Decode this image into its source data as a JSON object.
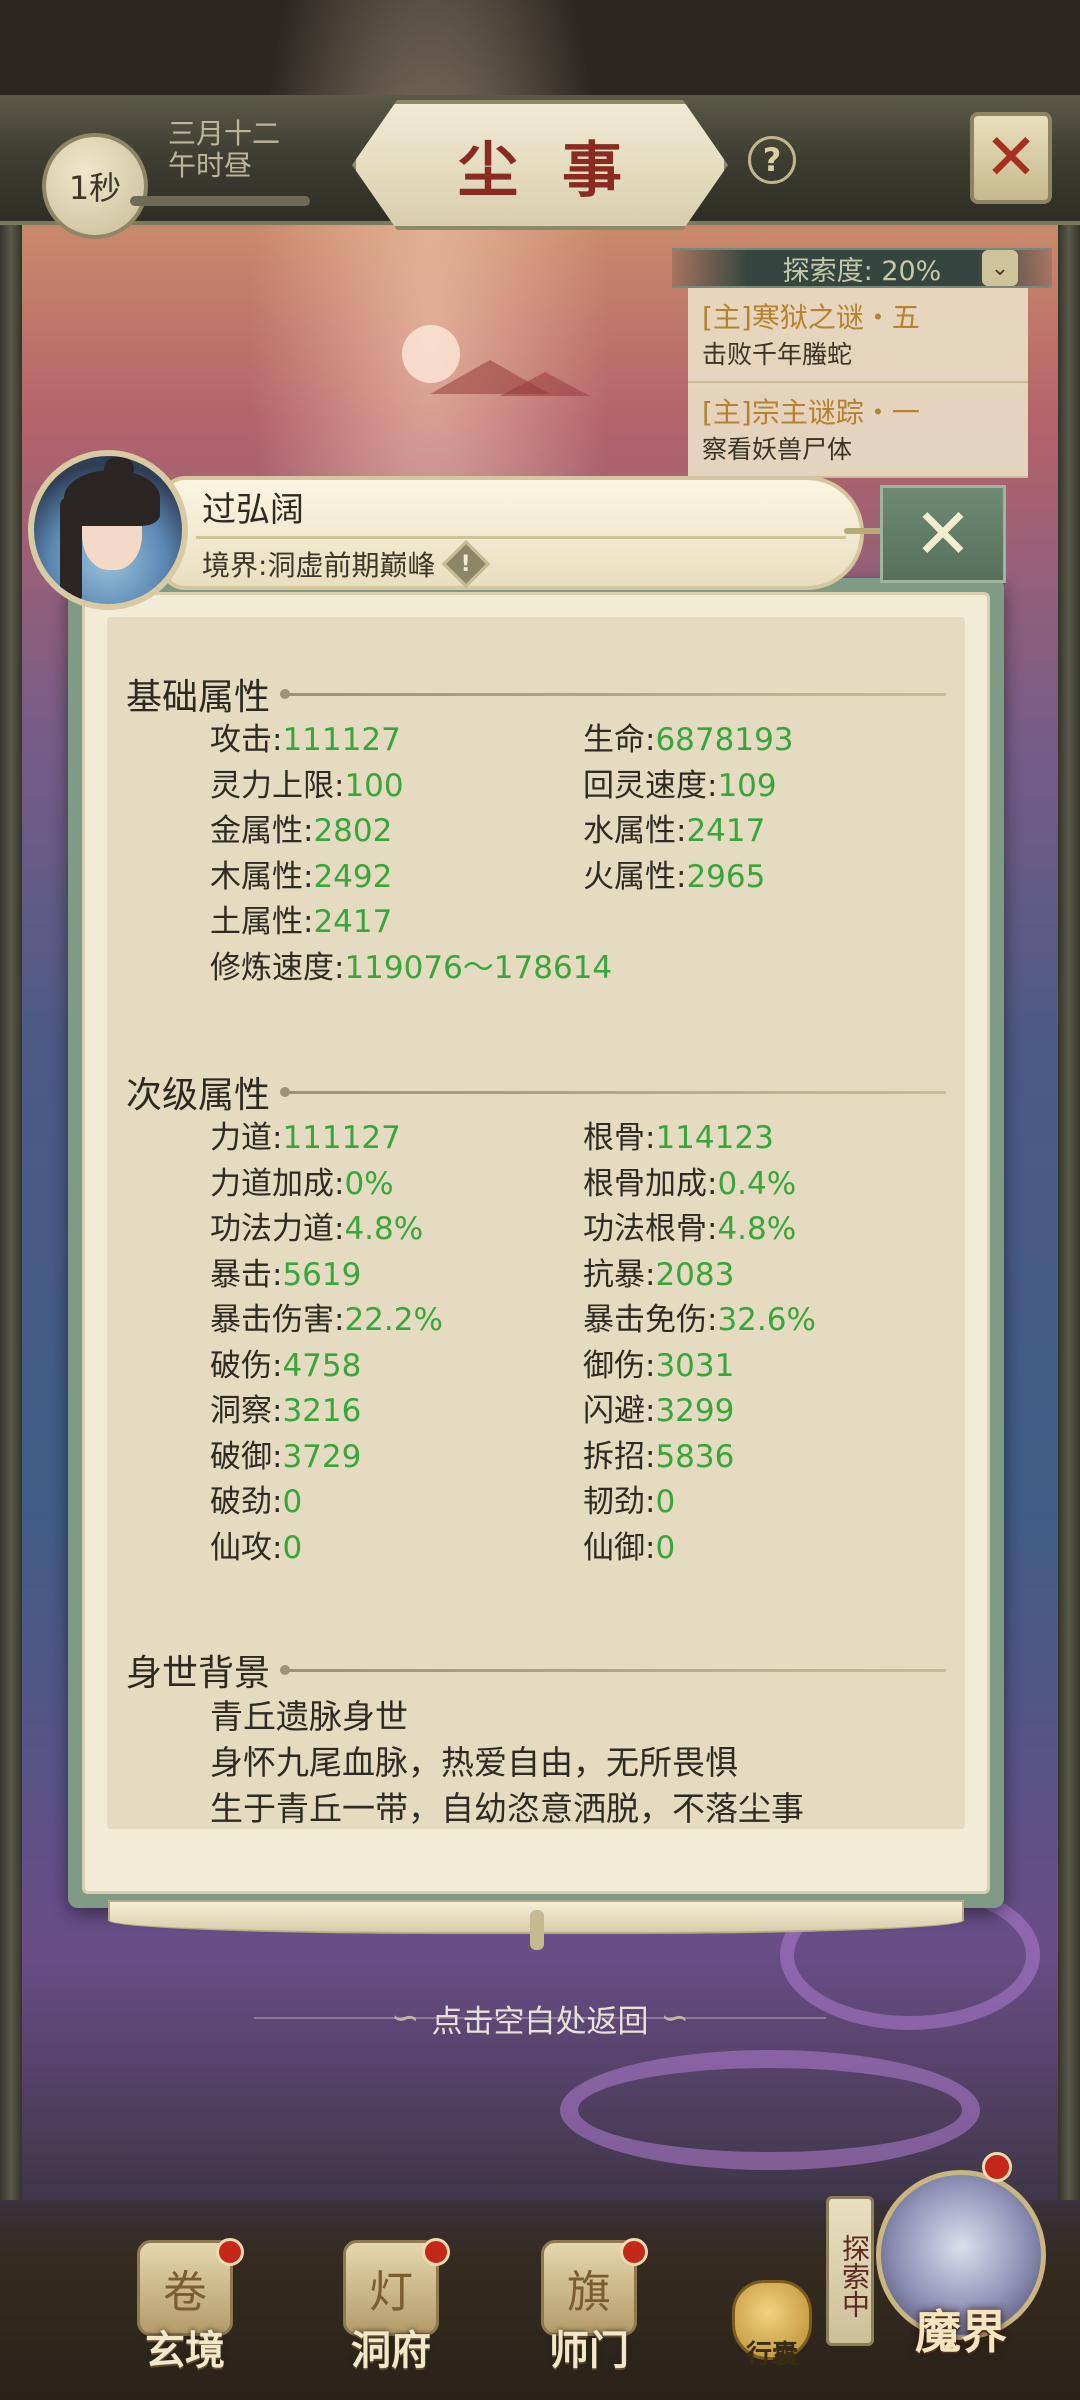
{
  "header": {
    "timer": "1秒",
    "date_line1": "三月十二",
    "date_line2": "午时昼",
    "title": "尘事",
    "help_label": "?",
    "close_label": "✕"
  },
  "explore": {
    "progress_text": "探索度: 20%",
    "progress_value": 0.2,
    "quests": [
      {
        "title": "[主]寒狱之谜・五",
        "desc": "击败千年螣蛇"
      },
      {
        "title": "[主]宗主谜踪・一",
        "desc": "察看妖兽尸体"
      }
    ]
  },
  "character": {
    "name": "过弘阔",
    "realm_label": "境界:",
    "realm_value": "洞虚前期巅峰",
    "realm_icon": "!"
  },
  "popup_close_label": "✕",
  "sections": {
    "basic": {
      "title": "基础属性",
      "attrs": [
        {
          "label": "攻击:",
          "value": "111127"
        },
        {
          "label": "生命:",
          "value": "6878193"
        },
        {
          "label": "灵力上限:",
          "value": "100"
        },
        {
          "label": "回灵速度:",
          "value": "109"
        },
        {
          "label": "金属性:",
          "value": "2802"
        },
        {
          "label": "水属性:",
          "value": "2417"
        },
        {
          "label": "木属性:",
          "value": "2492"
        },
        {
          "label": "火属性:",
          "value": "2965"
        },
        {
          "label": "土属性:",
          "value": "2417"
        },
        {
          "label": "修炼速度:",
          "value": "119076～178614"
        }
      ]
    },
    "secondary": {
      "title": "次级属性",
      "attrs": [
        {
          "label": "力道:",
          "value": "111127"
        },
        {
          "label": "根骨:",
          "value": "114123"
        },
        {
          "label": "力道加成:",
          "value": "0%"
        },
        {
          "label": "根骨加成:",
          "value": "0.4%"
        },
        {
          "label": "功法力道:",
          "value": "4.8%"
        },
        {
          "label": "功法根骨:",
          "value": "4.8%"
        },
        {
          "label": "暴击:",
          "value": "5619"
        },
        {
          "label": "抗暴:",
          "value": "2083"
        },
        {
          "label": "暴击伤害:",
          "value": "22.2%"
        },
        {
          "label": "暴击免伤:",
          "value": "32.6%"
        },
        {
          "label": "破伤:",
          "value": "4758"
        },
        {
          "label": "御伤:",
          "value": "3031"
        },
        {
          "label": "洞察:",
          "value": "3216"
        },
        {
          "label": "闪避:",
          "value": "3299"
        },
        {
          "label": "破御:",
          "value": "3729"
        },
        {
          "label": "拆招:",
          "value": "5836"
        },
        {
          "label": "破劲:",
          "value": "0"
        },
        {
          "label": "韧劲:",
          "value": "0"
        },
        {
          "label": "仙攻:",
          "value": "0"
        },
        {
          "label": "仙御:",
          "value": "0"
        }
      ]
    },
    "background": {
      "title": "身世背景",
      "lines": [
        "青丘遗脉身世",
        "身怀九尾血脉，热爱自由，无所畏惧",
        "生于青丘一带，自幼恣意洒脱，不落尘事"
      ]
    }
  },
  "return_hint": "点击空白处返回",
  "bottom_nav": {
    "items": [
      {
        "label": "玄境",
        "icon": "scroll-icon"
      },
      {
        "label": "洞府",
        "icon": "lantern-icon"
      },
      {
        "label": "师门",
        "icon": "banner-icon"
      }
    ],
    "bag_label": "行囊",
    "explore_tag": "探索中",
    "demon_label": "魔界"
  },
  "colors": {
    "value_green": "#3aa53a",
    "title_red": "#8a2b22",
    "quest_gold": "#b5822f",
    "popup_frame": "#7f9b85",
    "badge_red": "#c4281b"
  }
}
